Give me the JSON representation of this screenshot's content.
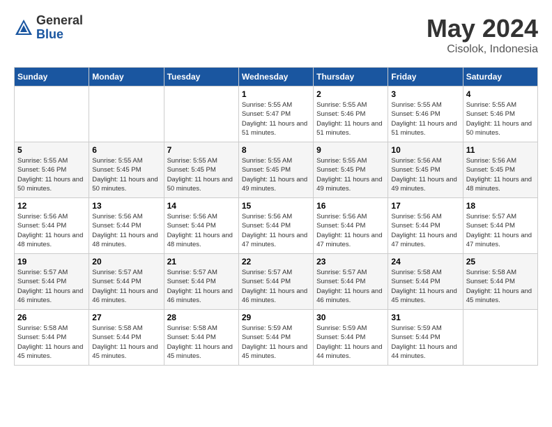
{
  "header": {
    "logo_general": "General",
    "logo_blue": "Blue",
    "month_title": "May 2024",
    "location": "Cisolok, Indonesia"
  },
  "days_of_week": [
    "Sunday",
    "Monday",
    "Tuesday",
    "Wednesday",
    "Thursday",
    "Friday",
    "Saturday"
  ],
  "weeks": [
    [
      {
        "day": "",
        "sunrise": "",
        "sunset": "",
        "daylight": ""
      },
      {
        "day": "",
        "sunrise": "",
        "sunset": "",
        "daylight": ""
      },
      {
        "day": "",
        "sunrise": "",
        "sunset": "",
        "daylight": ""
      },
      {
        "day": "1",
        "sunrise": "Sunrise: 5:55 AM",
        "sunset": "Sunset: 5:47 PM",
        "daylight": "Daylight: 11 hours and 51 minutes."
      },
      {
        "day": "2",
        "sunrise": "Sunrise: 5:55 AM",
        "sunset": "Sunset: 5:46 PM",
        "daylight": "Daylight: 11 hours and 51 minutes."
      },
      {
        "day": "3",
        "sunrise": "Sunrise: 5:55 AM",
        "sunset": "Sunset: 5:46 PM",
        "daylight": "Daylight: 11 hours and 51 minutes."
      },
      {
        "day": "4",
        "sunrise": "Sunrise: 5:55 AM",
        "sunset": "Sunset: 5:46 PM",
        "daylight": "Daylight: 11 hours and 50 minutes."
      }
    ],
    [
      {
        "day": "5",
        "sunrise": "Sunrise: 5:55 AM",
        "sunset": "Sunset: 5:46 PM",
        "daylight": "Daylight: 11 hours and 50 minutes."
      },
      {
        "day": "6",
        "sunrise": "Sunrise: 5:55 AM",
        "sunset": "Sunset: 5:45 PM",
        "daylight": "Daylight: 11 hours and 50 minutes."
      },
      {
        "day": "7",
        "sunrise": "Sunrise: 5:55 AM",
        "sunset": "Sunset: 5:45 PM",
        "daylight": "Daylight: 11 hours and 50 minutes."
      },
      {
        "day": "8",
        "sunrise": "Sunrise: 5:55 AM",
        "sunset": "Sunset: 5:45 PM",
        "daylight": "Daylight: 11 hours and 49 minutes."
      },
      {
        "day": "9",
        "sunrise": "Sunrise: 5:55 AM",
        "sunset": "Sunset: 5:45 PM",
        "daylight": "Daylight: 11 hours and 49 minutes."
      },
      {
        "day": "10",
        "sunrise": "Sunrise: 5:56 AM",
        "sunset": "Sunset: 5:45 PM",
        "daylight": "Daylight: 11 hours and 49 minutes."
      },
      {
        "day": "11",
        "sunrise": "Sunrise: 5:56 AM",
        "sunset": "Sunset: 5:45 PM",
        "daylight": "Daylight: 11 hours and 48 minutes."
      }
    ],
    [
      {
        "day": "12",
        "sunrise": "Sunrise: 5:56 AM",
        "sunset": "Sunset: 5:44 PM",
        "daylight": "Daylight: 11 hours and 48 minutes."
      },
      {
        "day": "13",
        "sunrise": "Sunrise: 5:56 AM",
        "sunset": "Sunset: 5:44 PM",
        "daylight": "Daylight: 11 hours and 48 minutes."
      },
      {
        "day": "14",
        "sunrise": "Sunrise: 5:56 AM",
        "sunset": "Sunset: 5:44 PM",
        "daylight": "Daylight: 11 hours and 48 minutes."
      },
      {
        "day": "15",
        "sunrise": "Sunrise: 5:56 AM",
        "sunset": "Sunset: 5:44 PM",
        "daylight": "Daylight: 11 hours and 47 minutes."
      },
      {
        "day": "16",
        "sunrise": "Sunrise: 5:56 AM",
        "sunset": "Sunset: 5:44 PM",
        "daylight": "Daylight: 11 hours and 47 minutes."
      },
      {
        "day": "17",
        "sunrise": "Sunrise: 5:56 AM",
        "sunset": "Sunset: 5:44 PM",
        "daylight": "Daylight: 11 hours and 47 minutes."
      },
      {
        "day": "18",
        "sunrise": "Sunrise: 5:57 AM",
        "sunset": "Sunset: 5:44 PM",
        "daylight": "Daylight: 11 hours and 47 minutes."
      }
    ],
    [
      {
        "day": "19",
        "sunrise": "Sunrise: 5:57 AM",
        "sunset": "Sunset: 5:44 PM",
        "daylight": "Daylight: 11 hours and 46 minutes."
      },
      {
        "day": "20",
        "sunrise": "Sunrise: 5:57 AM",
        "sunset": "Sunset: 5:44 PM",
        "daylight": "Daylight: 11 hours and 46 minutes."
      },
      {
        "day": "21",
        "sunrise": "Sunrise: 5:57 AM",
        "sunset": "Sunset: 5:44 PM",
        "daylight": "Daylight: 11 hours and 46 minutes."
      },
      {
        "day": "22",
        "sunrise": "Sunrise: 5:57 AM",
        "sunset": "Sunset: 5:44 PM",
        "daylight": "Daylight: 11 hours and 46 minutes."
      },
      {
        "day": "23",
        "sunrise": "Sunrise: 5:57 AM",
        "sunset": "Sunset: 5:44 PM",
        "daylight": "Daylight: 11 hours and 46 minutes."
      },
      {
        "day": "24",
        "sunrise": "Sunrise: 5:58 AM",
        "sunset": "Sunset: 5:44 PM",
        "daylight": "Daylight: 11 hours and 45 minutes."
      },
      {
        "day": "25",
        "sunrise": "Sunrise: 5:58 AM",
        "sunset": "Sunset: 5:44 PM",
        "daylight": "Daylight: 11 hours and 45 minutes."
      }
    ],
    [
      {
        "day": "26",
        "sunrise": "Sunrise: 5:58 AM",
        "sunset": "Sunset: 5:44 PM",
        "daylight": "Daylight: 11 hours and 45 minutes."
      },
      {
        "day": "27",
        "sunrise": "Sunrise: 5:58 AM",
        "sunset": "Sunset: 5:44 PM",
        "daylight": "Daylight: 11 hours and 45 minutes."
      },
      {
        "day": "28",
        "sunrise": "Sunrise: 5:58 AM",
        "sunset": "Sunset: 5:44 PM",
        "daylight": "Daylight: 11 hours and 45 minutes."
      },
      {
        "day": "29",
        "sunrise": "Sunrise: 5:59 AM",
        "sunset": "Sunset: 5:44 PM",
        "daylight": "Daylight: 11 hours and 45 minutes."
      },
      {
        "day": "30",
        "sunrise": "Sunrise: 5:59 AM",
        "sunset": "Sunset: 5:44 PM",
        "daylight": "Daylight: 11 hours and 44 minutes."
      },
      {
        "day": "31",
        "sunrise": "Sunrise: 5:59 AM",
        "sunset": "Sunset: 5:44 PM",
        "daylight": "Daylight: 11 hours and 44 minutes."
      },
      {
        "day": "",
        "sunrise": "",
        "sunset": "",
        "daylight": ""
      }
    ]
  ]
}
